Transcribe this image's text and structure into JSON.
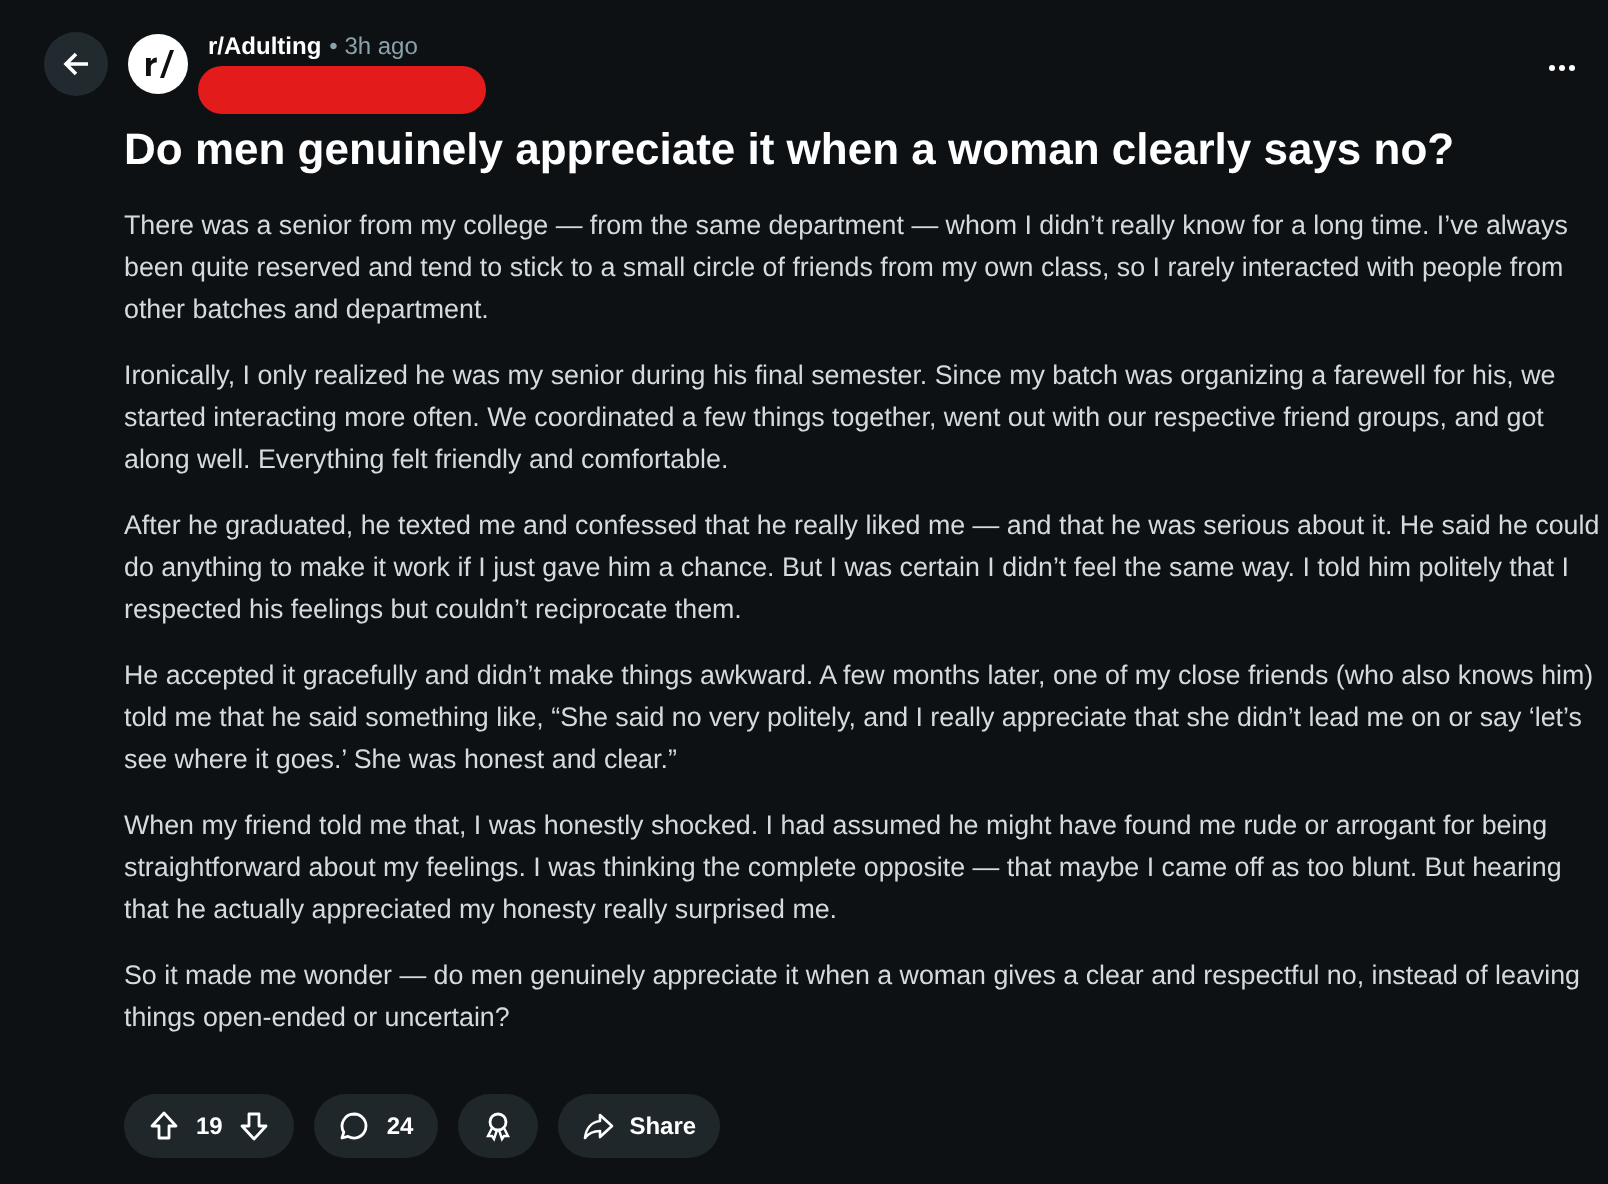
{
  "post": {
    "subreddit": "r/Adulting",
    "time": "• 3h ago",
    "author_redacted": true,
    "title": "Do men genuinely appreciate it when a woman clearly says no?",
    "paragraphs": [
      "There was a senior from my college — from the same department — whom I didn’t really know for a long time. I’ve always been quite reserved and tend to stick to a small circle of friends from my own class, so I rarely interacted with people from other batches and department.",
      "Ironically, I only realized he was my senior during his final semester. Since my batch was organizing a farewell for his, we started interacting more often. We coordinated a few things together, went out with our respective friend groups, and got along well. Everything felt friendly and comfortable.",
      "After he graduated, he texted me and confessed that he really liked me — and that he was serious about it. He said he could do anything to make it work if I just gave him a chance. But I was certain I didn’t feel the same way. I told him politely that I respected his feelings but couldn’t reciprocate them.",
      "He accepted it gracefully and didn’t make things awkward. A few months later, one of my close friends (who also knows him) told me that he said something like, “She said no very politely, and I really appreciate that she didn’t lead me on or say ‘let’s see where it goes.’ She was honest and clear.”",
      "When my friend told me that, I was honestly shocked. I had assumed he might have found me rude or arrogant for being straightforward about my feelings. I was thinking the complete opposite — that maybe I came off as too blunt. But hearing that he actually appreciated my honesty really surprised me.",
      "So it made me wonder — do men genuinely appreciate it when a woman gives a clear and respectful no, instead of leaving things open-ended or uncertain?"
    ]
  },
  "actions": {
    "votes": "19",
    "comments": "24",
    "share": "Share"
  }
}
